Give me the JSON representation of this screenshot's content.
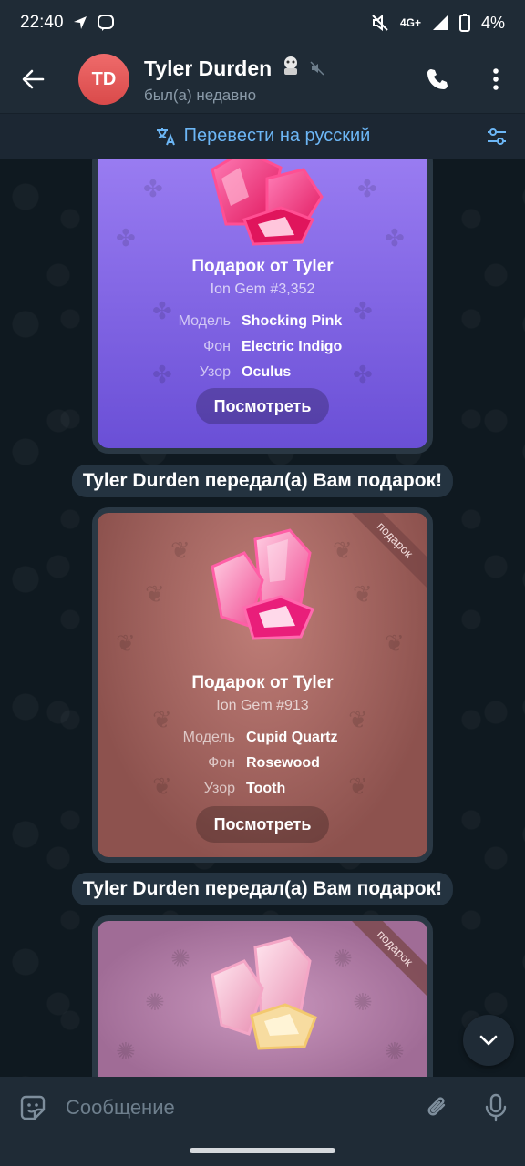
{
  "status_bar": {
    "time": "22:40",
    "network": "4G+",
    "battery": "4%"
  },
  "header": {
    "avatar_initials": "TD",
    "name": "Tyler Durden",
    "status": "был(а) недавно"
  },
  "translate_bar": {
    "label": "Перевести на русский"
  },
  "gifts": [
    {
      "title": "Подарок от Tyler",
      "subtitle": "Ion Gem #3,352",
      "attributes": [
        {
          "label": "Модель",
          "value": "Shocking Pink"
        },
        {
          "label": "Фон",
          "value": "Electric Indigo"
        },
        {
          "label": "Узор",
          "value": "Oculus"
        }
      ],
      "button": "Посмотреть",
      "bg_top": "#9a7df2",
      "bg_bottom": "#6a4fd6"
    },
    {
      "ribbon": "подарок",
      "title": "Подарок от Tyler",
      "subtitle": "Ion Gem #913",
      "attributes": [
        {
          "label": "Модель",
          "value": "Cupid Quartz"
        },
        {
          "label": "Фон",
          "value": "Rosewood"
        },
        {
          "label": "Узор",
          "value": "Tooth"
        }
      ],
      "button": "Посмотреть",
      "bg_top": "#b06f6a",
      "bg_bottom": "#8d524e"
    },
    {
      "ribbon": "подарок",
      "bg_top": "#b985ae",
      "bg_bottom": "#a06c96"
    }
  ],
  "service_messages": [
    "Tyler Durden передал(а) Вам подарок!",
    "Tyler Durden передал(а) Вам подарок!"
  ],
  "input": {
    "placeholder": "Сообщение"
  },
  "colors": {
    "accent": "#6cb6f5",
    "header_bg": "#1f2b36",
    "avatar": "#e35a5a"
  }
}
